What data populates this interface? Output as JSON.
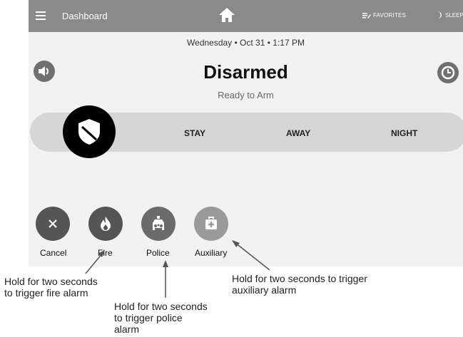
{
  "topbar": {
    "title": "Dashboard",
    "favorites_label": "FAVORITES",
    "sleep_label": "SLEEP"
  },
  "status": {
    "datetime": "Wednesday  •  Oct 31  •  1:17 PM",
    "title": "Disarmed",
    "subtitle": "Ready to Arm"
  },
  "modes": {
    "stay": "STAY",
    "away": "AWAY",
    "night": "NIGHT"
  },
  "panic_buttons": {
    "cancel": "Cancel",
    "fire": "Fire",
    "police": "Police",
    "auxiliary": "Auxiliary"
  },
  "callouts": {
    "fire": [
      "Hold for two seconds",
      "to trigger fire alarm"
    ],
    "police": [
      "Hold for two seconds",
      "to trigger police",
      "alarm"
    ],
    "auxiliary": [
      "Hold for two seconds to trigger",
      "auxiliary alarm"
    ]
  },
  "colors": {
    "topbar": "#8a8a8a",
    "cancel": "#555555",
    "fire": "#555555",
    "police": "#6b6b6b",
    "auxiliary": "#9a9a9a"
  }
}
